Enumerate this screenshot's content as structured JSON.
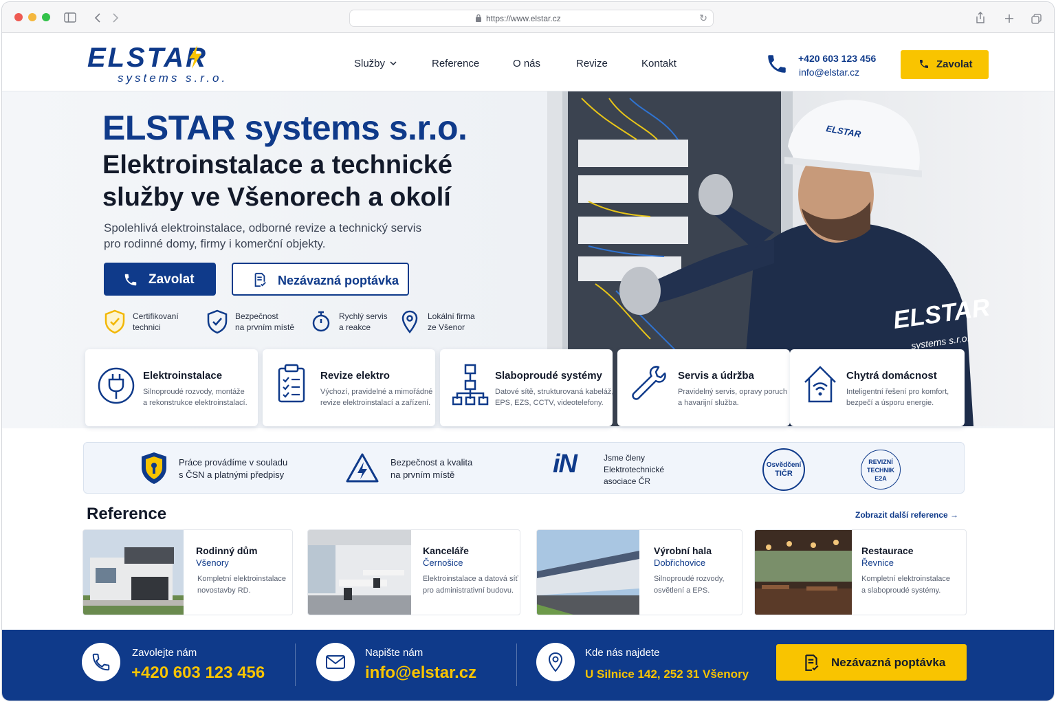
{
  "browser": {
    "url": "https://www.elstar.cz",
    "icons": [
      "sidebar-icon",
      "back-icon",
      "forward-icon",
      "lock-icon",
      "reload-icon",
      "share-icon",
      "new-tab-icon",
      "tabs-icon"
    ]
  },
  "header": {
    "logo_main": "ELSTAR",
    "logo_sub": "systems s.r.o.",
    "nav": [
      "Služby",
      "Reference",
      "O nás",
      "Revize",
      "Kontakt"
    ],
    "phone": "+420 603 123 456",
    "email": "info@elstar.cz",
    "call_button": "Zavolat"
  },
  "hero": {
    "title": "ELSTAR systems s.r.o.",
    "subtitle_line1": "Elektroinstalace a technické",
    "subtitle_line2": "služby ve Všenorech a okolí",
    "desc_line1": "Spolehlivá elektroinstalace, odborné revize a technický servis",
    "desc_line2": "pro rodinné domy, firmy i komerční objekty.",
    "call_button": "Zavolat",
    "quote_button": "Nezávazná poptávka",
    "photo_helmet_text": "ELSTAR",
    "photo_back_text_1": "ELSTAR",
    "photo_back_text_2": "systems s.r.o.",
    "badges": [
      {
        "line1": "Certifikovaní",
        "line2": "technici",
        "icon": "shield-check-icon"
      },
      {
        "line1": "Bezpečnost",
        "line2": "na prvním místě",
        "icon": "shield-icon"
      },
      {
        "line1": "Rychlý servis",
        "line2": "a reakce",
        "icon": "stopwatch-icon"
      },
      {
        "line1": "Lokální firma",
        "line2": "ze Všenor",
        "icon": "location-pin-icon"
      }
    ]
  },
  "services": [
    {
      "title": "Elektroinstalace",
      "d1": "Silnoproudé rozvody, montáže",
      "d2": "a rekonstrukce elektroinstalací.",
      "icon": "plug-icon"
    },
    {
      "title": "Revize elektro",
      "d1": "Výchozí, pravidelné a mimořádné",
      "d2": "revize elektroinstalací a zařízení.",
      "icon": "clipboard-icon"
    },
    {
      "title": "Slaboproudé systémy",
      "d1": "Datové sítě, strukturovaná kabeláž,",
      "d2": "EPS, EZS, CCTV, videotelefony.",
      "icon": "network-icon"
    },
    {
      "title": "Servis a údržba",
      "d1": "Pravidelný servis, opravy poruch",
      "d2": "a havarijní služba.",
      "icon": "wrench-icon"
    },
    {
      "title": "Chytrá domácnost",
      "d1": "Inteligentní řešení pro komfort,",
      "d2": "bezpečí a úsporu energie.",
      "icon": "smart-home-icon"
    }
  ],
  "band": {
    "item1_l1": "Práce provádíme v souladu",
    "item1_l2": "s ČSN a platnými předpisy",
    "item2_l1": "Bezpečnost a kvalita",
    "item2_l2": "na prvním místě",
    "item3_logo": "iN",
    "item3_l1": "Jsme členy",
    "item3_l2": "Elektrotechnické",
    "item3_l3": "asociace ČR",
    "seal1_l1": "Osvědčení",
    "seal1_l2": "TIČR",
    "seal2_l1": "REVIZNÍ",
    "seal2_l2": "TECHNIK",
    "seal2_l3": "E2A"
  },
  "references": {
    "title": "Reference",
    "more": "Zobrazit další reference →",
    "items": [
      {
        "title": "Rodinný dům",
        "location": "Všenory",
        "d1": "Kompletní elektroinstalace",
        "d2": "novostavby RD."
      },
      {
        "title": "Kanceláře",
        "location": "Černošice",
        "d1": "Elektroinstalace a datová síť",
        "d2": "pro administrativní budovu."
      },
      {
        "title": "Výrobní hala",
        "location": "Dobřichovice",
        "d1": "Silnoproudé rozvody,",
        "d2": "osvětlení a EPS."
      },
      {
        "title": "Restaurace",
        "location": "Řevnice",
        "d1": "Kompletní elektroinstalace",
        "d2": "a slaboproudé systémy."
      }
    ]
  },
  "footer": {
    "call_label": "Zavolejte nám",
    "call_value": "+420 603 123 456",
    "mail_label": "Napište nám",
    "mail_value": "info@elstar.cz",
    "addr_label": "Kde nás najdete",
    "addr_value": "U Silnice 142, 252 31 Všenory",
    "quote_button": "Nezávazná poptávka"
  },
  "colors": {
    "brand": "#0f3a8a",
    "accent": "#f9c400"
  }
}
